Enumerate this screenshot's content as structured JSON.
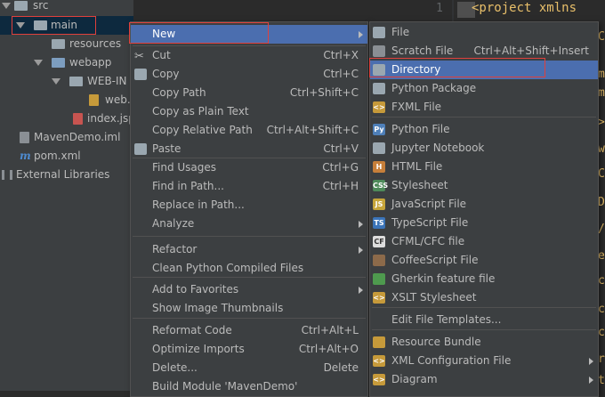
{
  "tree": {
    "items": [
      {
        "label": "src"
      },
      {
        "label": "main"
      },
      {
        "label": "resources"
      },
      {
        "label": "webapp"
      },
      {
        "label": "WEB-IN"
      },
      {
        "label": "web."
      },
      {
        "label": "index.jsp"
      },
      {
        "label": "MavenDemo.iml"
      },
      {
        "label": "pom.xml"
      },
      {
        "label": "External Libraries"
      }
    ]
  },
  "editor": {
    "line_number": "1",
    "first_line": "<project xmlns",
    "side_chars": [
      "C",
      "m",
      "m",
      ">",
      "w",
      "C",
      "D",
      "/",
      "e",
      "c",
      "c",
      "c",
      "r",
      "t"
    ]
  },
  "context_menu": {
    "items": [
      {
        "label": "New",
        "shortcut": "",
        "submenu": true
      },
      {
        "label": "Cut",
        "shortcut": "Ctrl+X"
      },
      {
        "label": "Copy",
        "shortcut": "Ctrl+C"
      },
      {
        "label": "Copy Path",
        "shortcut": "Ctrl+Shift+C"
      },
      {
        "label": "Copy as Plain Text",
        "shortcut": ""
      },
      {
        "label": "Copy Relative Path",
        "shortcut": "Ctrl+Alt+Shift+C"
      },
      {
        "label": "Paste",
        "shortcut": "Ctrl+V"
      },
      {
        "label": "Find Usages",
        "shortcut": "Ctrl+G"
      },
      {
        "label": "Find in Path...",
        "shortcut": "Ctrl+H"
      },
      {
        "label": "Replace in Path...",
        "shortcut": ""
      },
      {
        "label": "Analyze",
        "shortcut": "",
        "submenu": true
      },
      {
        "label": "Refactor",
        "shortcut": "",
        "submenu": true
      },
      {
        "label": "Clean Python Compiled Files",
        "shortcut": ""
      },
      {
        "label": "Add to Favorites",
        "shortcut": "",
        "submenu": true
      },
      {
        "label": "Show Image Thumbnails",
        "shortcut": ""
      },
      {
        "label": "Reformat Code",
        "shortcut": "Ctrl+Alt+L"
      },
      {
        "label": "Optimize Imports",
        "shortcut": "Ctrl+Alt+O"
      },
      {
        "label": "Delete...",
        "shortcut": "Delete"
      },
      {
        "label": "Build Module 'MavenDemo'",
        "shortcut": ""
      }
    ]
  },
  "new_submenu": {
    "items": [
      {
        "label": "File",
        "shortcut": ""
      },
      {
        "label": "Scratch File",
        "shortcut": "Ctrl+Alt+Shift+Insert"
      },
      {
        "label": "Directory",
        "shortcut": ""
      },
      {
        "label": "Python Package",
        "shortcut": ""
      },
      {
        "label": "FXML File",
        "shortcut": ""
      },
      {
        "label": "Python File",
        "shortcut": ""
      },
      {
        "label": "Jupyter Notebook",
        "shortcut": ""
      },
      {
        "label": "HTML File",
        "shortcut": ""
      },
      {
        "label": "Stylesheet",
        "shortcut": ""
      },
      {
        "label": "JavaScript File",
        "shortcut": ""
      },
      {
        "label": "TypeScript File",
        "shortcut": ""
      },
      {
        "label": "CFML/CFC file",
        "shortcut": ""
      },
      {
        "label": "CoffeeScript File",
        "shortcut": ""
      },
      {
        "label": "Gherkin feature file",
        "shortcut": ""
      },
      {
        "label": "XSLT Stylesheet",
        "shortcut": ""
      },
      {
        "label": "Edit File Templates...",
        "shortcut": ""
      },
      {
        "label": "Resource Bundle",
        "shortcut": ""
      },
      {
        "label": "XML Configuration File",
        "shortcut": "",
        "submenu": true
      },
      {
        "label": "Diagram",
        "shortcut": "",
        "submenu": true
      }
    ]
  },
  "colors": {
    "highlight": "#4b6eaf",
    "annotation_box": "#e0403c"
  }
}
